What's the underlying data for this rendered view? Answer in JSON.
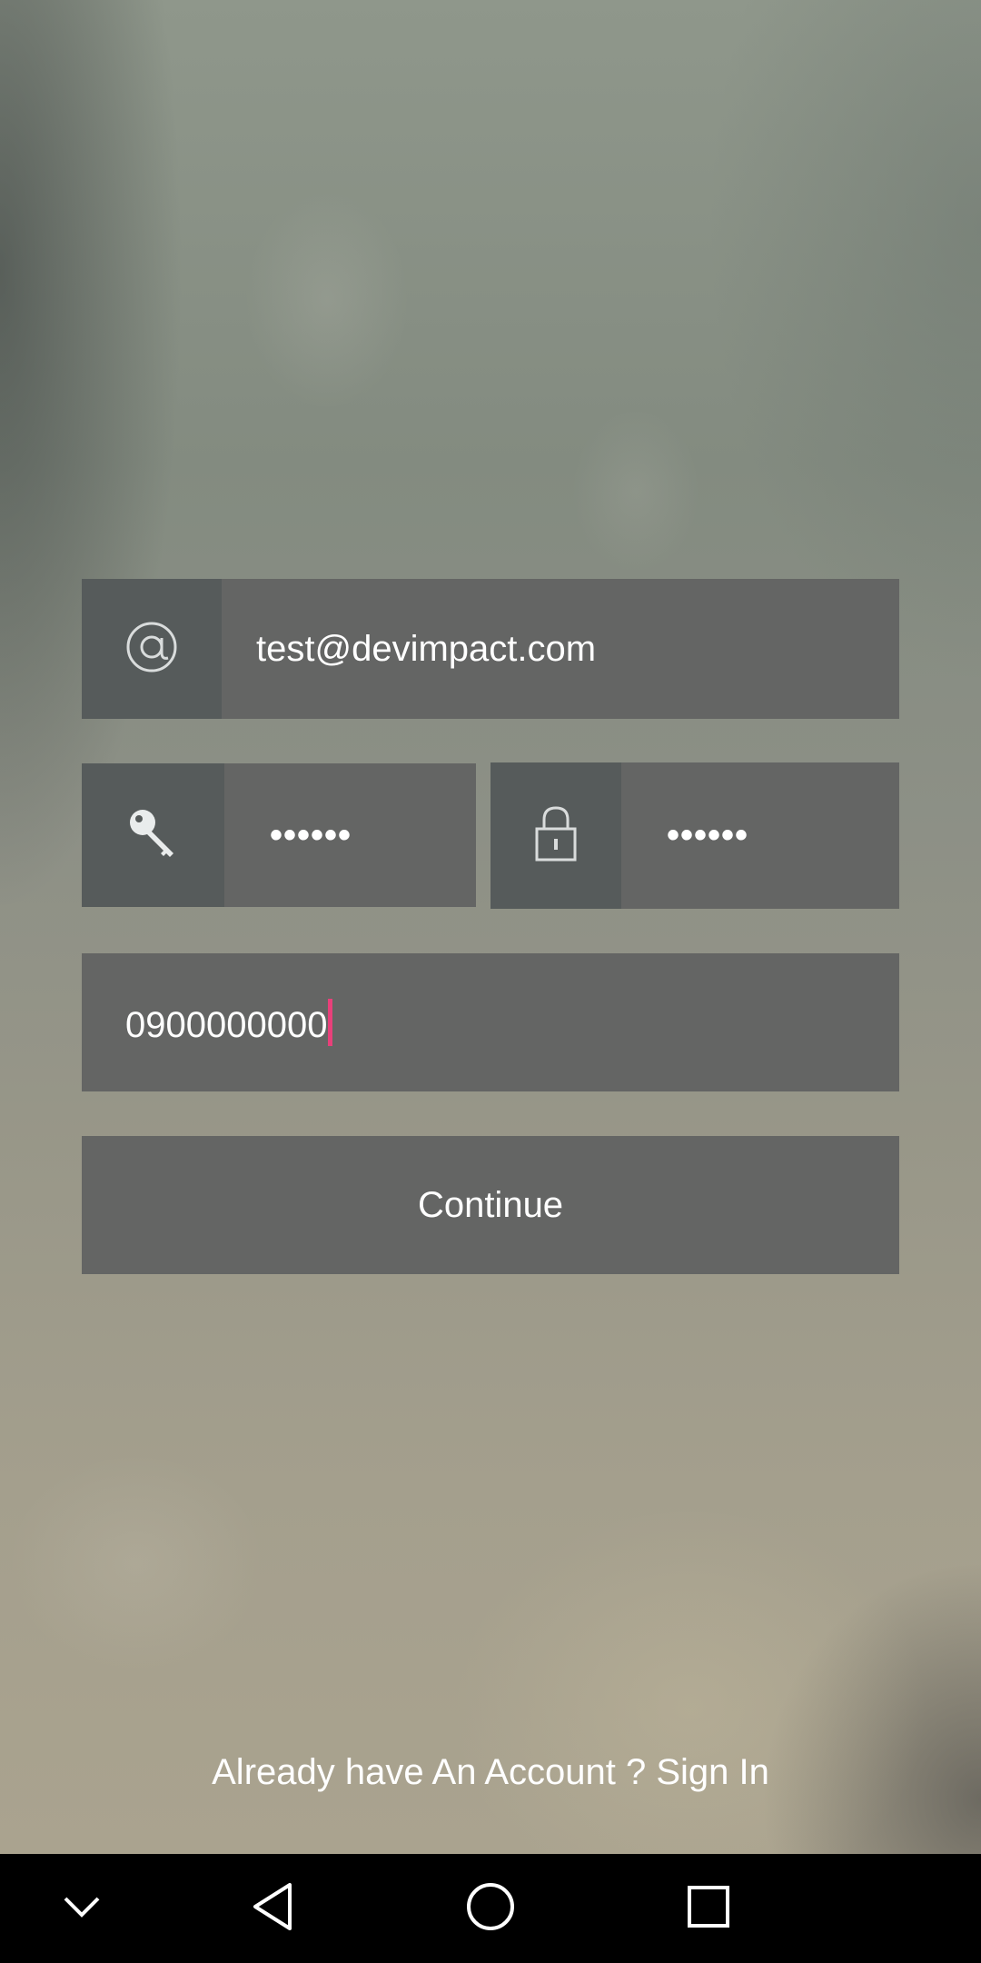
{
  "form": {
    "email": {
      "value": "test@devimpact.com",
      "icon": "at-sign-icon"
    },
    "password": {
      "value": "••••••",
      "icon": "key-icon"
    },
    "confirm_password": {
      "value": "••••••",
      "icon": "lock-icon"
    },
    "phone": {
      "value": "0900000000"
    },
    "continue_label": "Continue"
  },
  "footer": {
    "signin_text": "Already have An Account ? Sign In"
  },
  "navbar": {
    "items": [
      "chevron-down-icon",
      "back-icon",
      "home-icon",
      "recents-icon"
    ]
  },
  "colors": {
    "field_bg": "#646564",
    "icon_bg": "#565b5b",
    "cursor": "#e8407a"
  }
}
